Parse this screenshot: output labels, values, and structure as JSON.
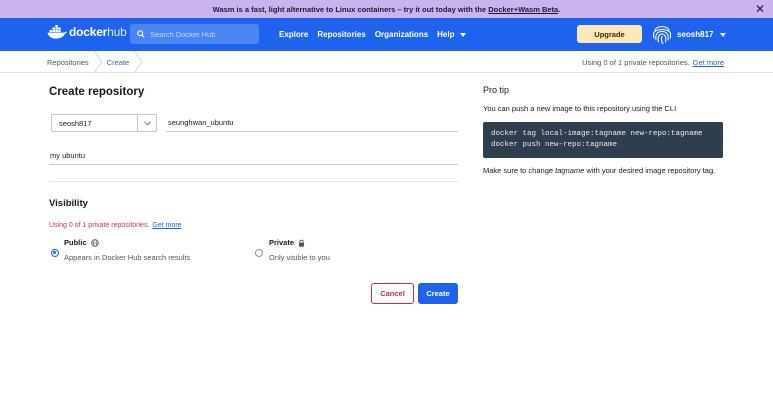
{
  "banner": {
    "text": "Wasm is a fast, light alternative to Linux containers – try it out today with the",
    "link": "Docker+Wasm Beta",
    "suffix": ".",
    "close": "✕"
  },
  "nav": {
    "brand_bold": "docker",
    "brand_light": "hub",
    "search_placeholder": "Search Docker Hub",
    "links": [
      "Explore",
      "Repositories",
      "Organizations",
      "Help"
    ],
    "upgrade_label": "Upgrade",
    "username": "seosh817"
  },
  "breadcrumb": {
    "items": [
      "Repositories",
      "Create"
    ],
    "usage_text": "Using 0 of 1 private repositories.",
    "usage_link": "Get more"
  },
  "form": {
    "title": "Create repository",
    "namespace": "seosh817",
    "repo_name": "seunghwan_ubuntu",
    "description": "my ubuntu",
    "visibility_title": "Visibility",
    "visibility_note": "Using 0 of 1 private repositories.",
    "visibility_link": "Get more",
    "options": [
      {
        "title": "Public",
        "desc": "Appears in Docker Hub search results",
        "selected": true
      },
      {
        "title": "Private",
        "desc": "Only visible to you",
        "selected": false
      }
    ],
    "cancel_label": "Cancel",
    "create_label": "Create"
  },
  "protip": {
    "title": "Pro tip",
    "intro": "You can push a new image to this repository using the CLI",
    "code": [
      "docker tag local-image:tagname new-repo:tagname",
      "docker push new-repo:tagname"
    ],
    "note_before": "Make sure to change",
    "note_italic": "tagname",
    "note_after": "with your desired image repository tag."
  },
  "colors": {
    "brand_blue": "#1d63ed",
    "banner_purple": "#c9b4f0",
    "upgrade_bg": "#fde6b8",
    "danger": "#c2314a",
    "code_bg": "#2f3e4c"
  }
}
